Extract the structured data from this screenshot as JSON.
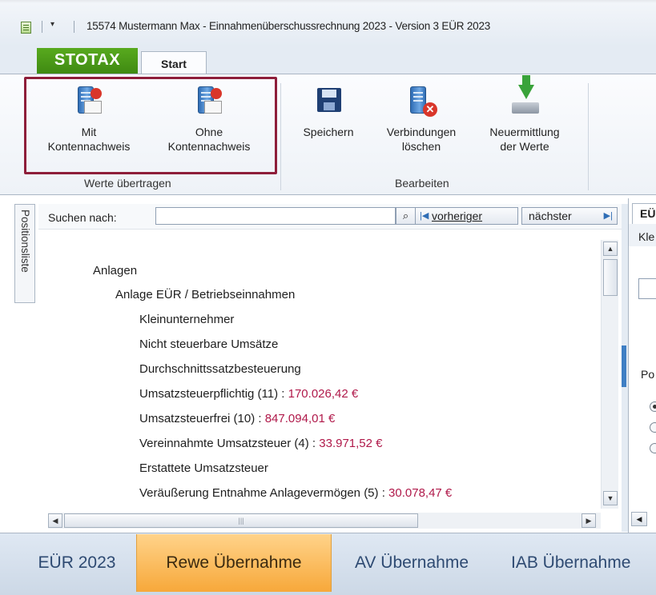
{
  "window": {
    "title": "15574 Mustermann Max - Einnahmenüberschussrechnung 2023 - Version 3 EÜR 2023"
  },
  "ribbon": {
    "app_tab": "STOTAX",
    "tabs": [
      "Start"
    ],
    "groups": [
      {
        "label": "Werte übertragen",
        "buttons": [
          {
            "label_line1": "Mit",
            "label_line2": "Kontennachweis",
            "icon": "server-mail-transfer-icon"
          },
          {
            "label_line1": "Ohne",
            "label_line2": "Kontennachweis",
            "icon": "server-mail-transfer-icon"
          }
        ]
      },
      {
        "label": "Bearbeiten",
        "buttons": [
          {
            "label_line1": "Speichern",
            "label_line2": "",
            "icon": "floppy-disk-icon"
          },
          {
            "label_line1": "Verbindungen",
            "label_line2": "löschen",
            "icon": "server-delete-icon"
          },
          {
            "label_line1": "Neuermittlung",
            "label_line2": "der Werte",
            "icon": "recalculate-download-icon"
          }
        ]
      }
    ]
  },
  "side_tab": "Positionsliste",
  "search": {
    "label": "Suchen nach:",
    "value": "",
    "find_icon": "magnifier-icon",
    "prev_label": "vorheriger",
    "next_label": "nächster"
  },
  "tree": [
    {
      "text": "Anlagen",
      "value": ""
    },
    {
      "text": "Anlage EÜR / Betriebseinnahmen",
      "value": ""
    },
    {
      "text": "Kleinunternehmer",
      "value": ""
    },
    {
      "text": "Nicht steuerbare Umsätze",
      "value": ""
    },
    {
      "text": "Durchschnittssatzbesteuerung",
      "value": ""
    },
    {
      "text": "Umsatzsteuerpflichtig (11) : ",
      "value": "170.026,42 €"
    },
    {
      "text": "Umsatzsteuerfrei (10) : ",
      "value": "847.094,01 €"
    },
    {
      "text": "Vereinnahmte Umsatzsteuer (4) : ",
      "value": "33.971,52 €"
    },
    {
      "text": "Erstattete Umsatzsteuer",
      "value": ""
    },
    {
      "text": "Veräußerung Entnahme Anlagevermögen (5) : ",
      "value": "30.078,47 €"
    }
  ],
  "right_pane": {
    "tab": "EÜ",
    "sub": "Kle",
    "label": "Po"
  },
  "bottom_tabs": [
    "EÜR 2023",
    "Rewe Übernahme",
    "AV Übernahme",
    "IAB Übernahme"
  ],
  "active_bottom_tab": "Rewe Übernahme",
  "colors": {
    "brand_green": "#4a9a18",
    "value_red": "#b0194a",
    "highlight_border": "#8e1e3a",
    "active_tab_orange": "#f7a83a"
  }
}
